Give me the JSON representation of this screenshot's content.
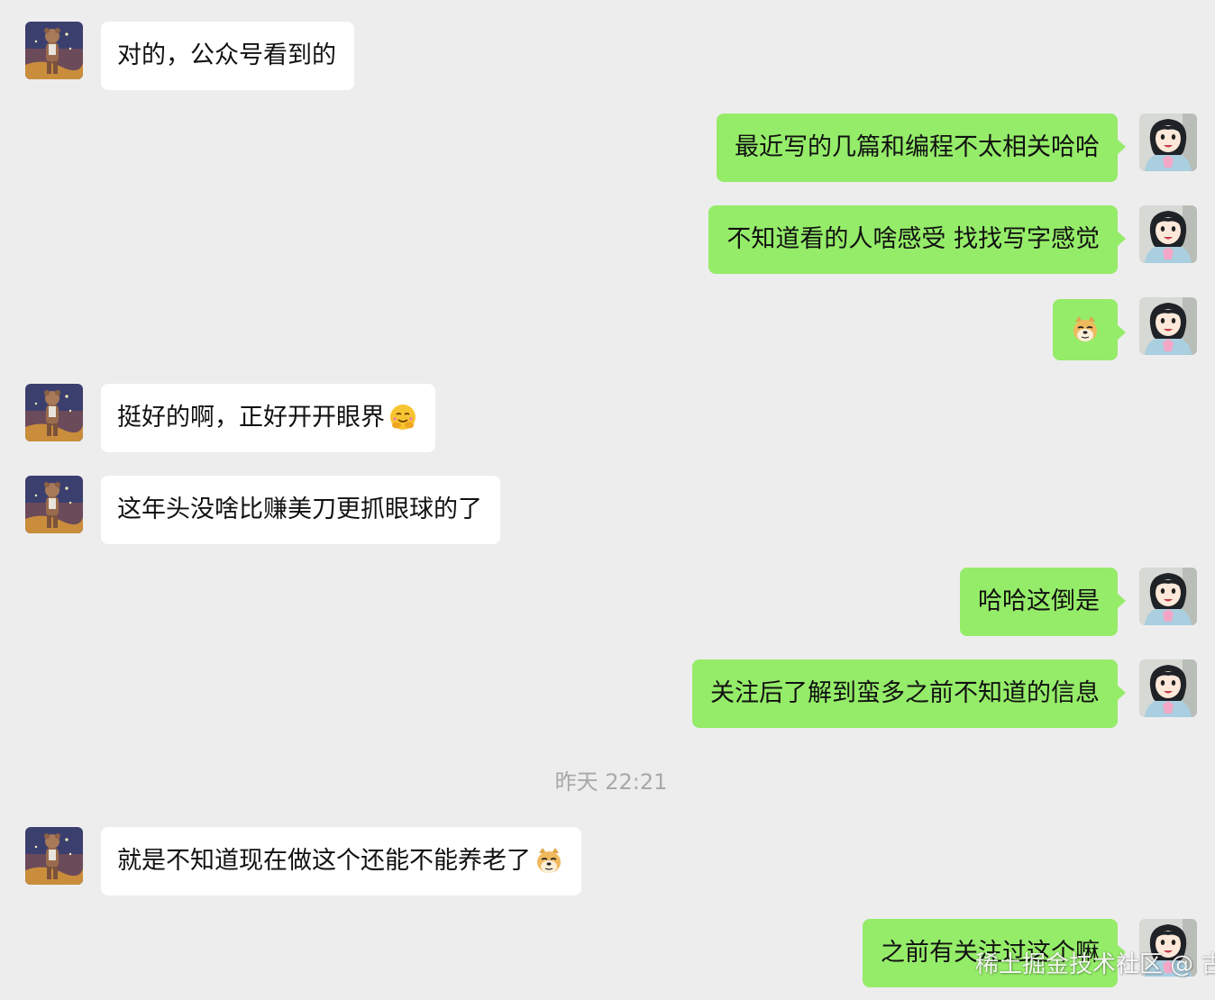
{
  "colors": {
    "background": "#ededed",
    "incoming_bubble": "#ffffff",
    "outgoing_bubble": "#95ec69",
    "timestamp_text": "#a8a8a8"
  },
  "messages": [
    {
      "direction": "in",
      "text": "对的，公众号看到的"
    },
    {
      "direction": "out",
      "text": "最近写的几篇和编程不太相关哈哈"
    },
    {
      "direction": "out",
      "text": "不知道看的人啥感受 找找写字感觉"
    },
    {
      "direction": "out",
      "text": "",
      "emoji": "doge-emoji"
    },
    {
      "direction": "in",
      "text": "挺好的啊，正好开开眼界",
      "emoji": "hugging-face-emoji"
    },
    {
      "direction": "in",
      "text": "这年头没啥比赚美刀更抓眼球的了"
    },
    {
      "direction": "out",
      "text": "哈哈这倒是"
    },
    {
      "direction": "out",
      "text": "关注后了解到蛮多之前不知道的信息"
    },
    {
      "direction": "in",
      "text": "就是不知道现在做这个还能不能养老了",
      "emoji": "doge-emoji"
    },
    {
      "direction": "out",
      "text": "之前有关注过这个嘛"
    }
  ],
  "timestamp": "昨天 22:21",
  "watermark": "稀土掘金技术社区 @ 古柳",
  "avatars": {
    "contact": "bear-figure-avatar",
    "self": "anime-girl-avatar"
  }
}
